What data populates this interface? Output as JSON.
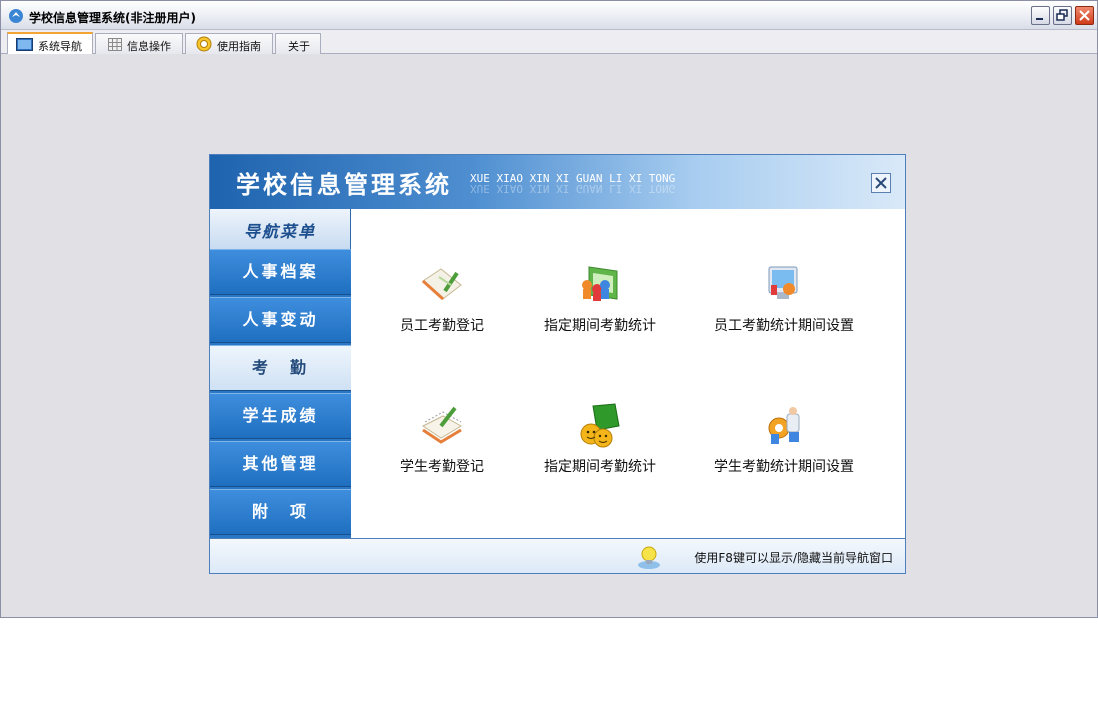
{
  "window": {
    "title": "学校信息管理系统(非注册用户)"
  },
  "tabs": [
    {
      "label": "系统导航",
      "icon": "monitor-icon"
    },
    {
      "label": "信息操作",
      "icon": "grid-icon"
    },
    {
      "label": "使用指南",
      "icon": "lifebuoy-icon"
    },
    {
      "label": "关于",
      "icon": ""
    }
  ],
  "nav_panel": {
    "title": "学校信息管理系统",
    "subtitle": "XUE XIAO XIN XI GUAN LI XI TONG",
    "menu_header": "导航菜单",
    "menu_items": [
      {
        "label": "人事档案",
        "active": false
      },
      {
        "label": "人事变动",
        "active": false
      },
      {
        "label": "考　勤",
        "active": true
      },
      {
        "label": "学生成绩",
        "active": false
      },
      {
        "label": "其他管理",
        "active": false
      },
      {
        "label": "附　项",
        "active": false
      }
    ],
    "functions": [
      {
        "label": "员工考勤登记",
        "icon": "notebook-pen-icon"
      },
      {
        "label": "指定期间考勤统计",
        "icon": "chart-people-icon"
      },
      {
        "label": "员工考勤统计期间设置",
        "icon": "settings-computer-icon"
      },
      {
        "label": "学生考勤登记",
        "icon": "notepad-pencil-icon"
      },
      {
        "label": "指定期间考勤统计",
        "icon": "smiley-faces-icon"
      },
      {
        "label": "学生考勤统计期间设置",
        "icon": "gear-people-icon"
      }
    ],
    "footer_tip": "使用F8键可以显示/隐藏当前导航窗口"
  },
  "colors": {
    "accent_blue": "#2a77c6",
    "tab_active_top": "#f3a534"
  }
}
